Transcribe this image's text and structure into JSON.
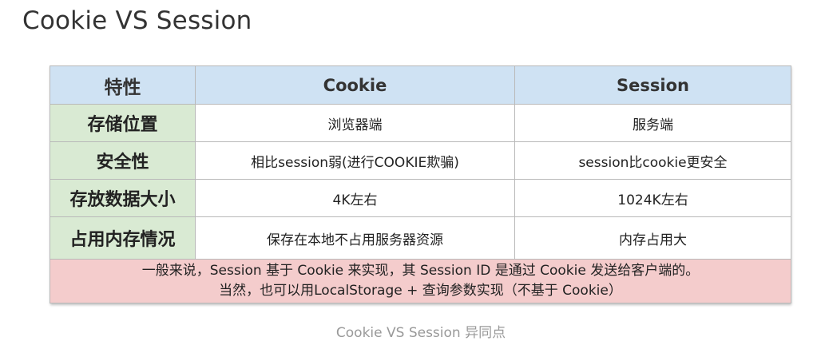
{
  "title": "Cookie VS Session",
  "table": {
    "headers": [
      "特性",
      "Cookie",
      "Session"
    ],
    "rows": [
      {
        "feature": "存储位置",
        "cookie": "浏览器端",
        "session": "服务端"
      },
      {
        "feature": "安全性",
        "cookie": "相比session弱(进行COOKIE欺骗)",
        "session": "session比cookie更安全"
      },
      {
        "feature": "存放数据大小",
        "cookie": "4K左右",
        "session": "1024K左右"
      },
      {
        "feature": "占用内存情况",
        "cookie": "保存在本地不占用服务器资源",
        "session": "内存占用大"
      }
    ],
    "footnote": [
      "一般来说，Session 基于 Cookie 来实现，其 Session ID 是通过 Cookie 发送给客户端的。",
      "当然，也可以用LocalStorage + 查询参数实现（不基于 Cookie）"
    ]
  },
  "caption": "Cookie VS Session 异同点",
  "colors": {
    "header_bg": "#cfe2f3",
    "feature_bg": "#d9ead3",
    "footnote_bg": "#f4cccc",
    "border": "#b9b9b9"
  }
}
